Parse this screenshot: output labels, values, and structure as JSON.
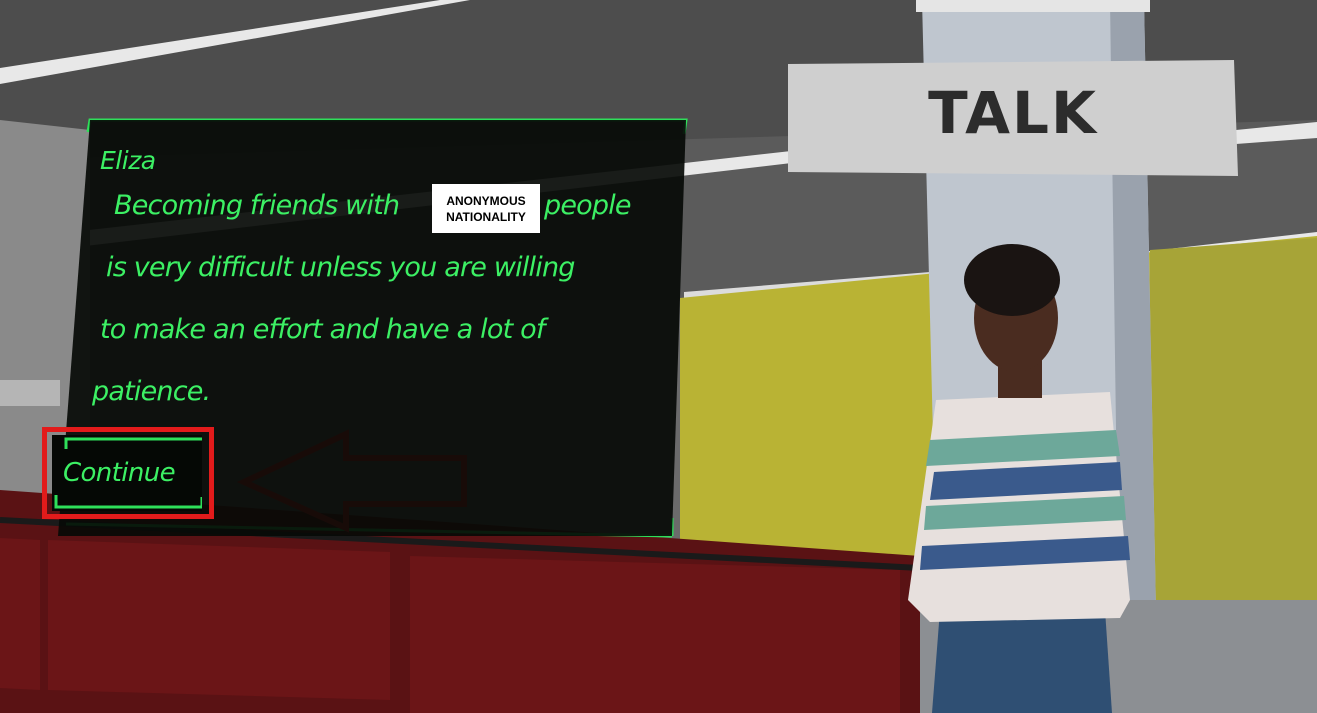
{
  "dialog": {
    "speaker": "Eliza",
    "lines": [
      "Becoming friends with",
      "people",
      "is very difficult unless you are willing",
      "to make an effort and have a lot of",
      "patience."
    ],
    "redaction": {
      "line1": "ANONYMOUS",
      "line2": "NATIONALITY"
    },
    "continue_label": "Continue"
  },
  "sign": {
    "label": "TALK"
  },
  "colors": {
    "dialog_text": "#3cf064",
    "dialog_border": "#2ee05a",
    "highlight": "#e21b1b",
    "wall_yellow": "#b9b334",
    "wall_red": "#6b1517"
  }
}
